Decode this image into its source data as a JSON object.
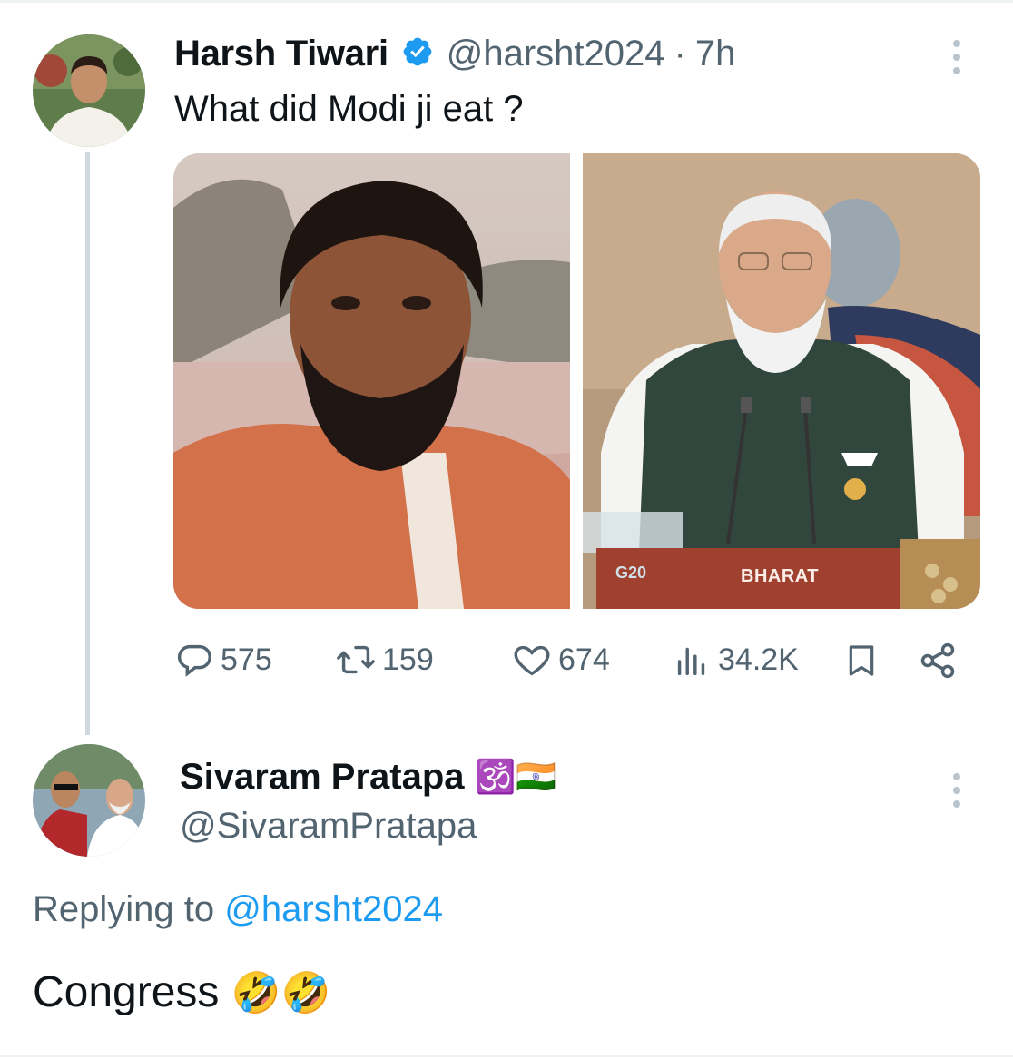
{
  "tweet": {
    "author_name": "Harsh Tiwari",
    "author_handle": "@harsht2024",
    "separator": "·",
    "time": "7h",
    "text": "What did Modi ji eat ?",
    "verified_icon": "verified-badge-icon",
    "media": {
      "left_image": "young-bearded-man-in-saffron-robe",
      "right_image": "man-at-g20-podium",
      "podium_label": "BHARAT",
      "podium_logo": "G20"
    },
    "metrics": {
      "replies": "575",
      "reposts": "159",
      "likes": "674",
      "views": "34.2K"
    }
  },
  "reply": {
    "author_name": "Sivaram Pratapa",
    "author_emojis": "🕉️🇮🇳",
    "author_handle": "@SivaramPratapa",
    "replying_prefix": "Replying to",
    "replying_handle": "@harsht2024",
    "text": "Congress",
    "text_emojis": "🤣🤣"
  },
  "colors": {
    "text": "#0f1419",
    "secondary": "#536471",
    "link": "#1d9bf0",
    "verified": "#1d9bf0",
    "thread_line": "#cfd9de"
  }
}
